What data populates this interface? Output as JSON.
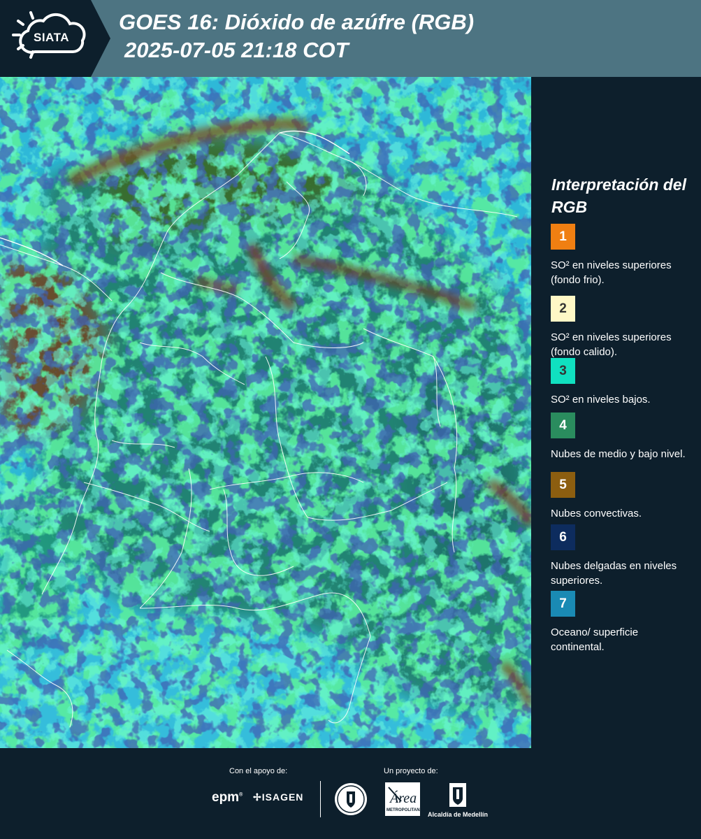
{
  "header": {
    "logo_text": "SIATA",
    "title_line1": "GOES 16: Dióxido de azúfre (RGB)",
    "title_line2": "2025-07-05 21:18 COT"
  },
  "legend": {
    "title": "Interpretación del RGB",
    "items": [
      {
        "number": "1",
        "color": "#f07f12",
        "text_color": "#ffffff",
        "desc": "SO² en niveles superiores (fondo frio)."
      },
      {
        "number": "2",
        "color": "#fff8c6",
        "text_color": "#333333",
        "desc": "SO² en niveles superiores (fondo calido)."
      },
      {
        "number": "3",
        "color": "#10e0c0",
        "text_color": "#333333",
        "desc": "SO² en niveles bajos."
      },
      {
        "number": "4",
        "color": "#2a8c5e",
        "text_color": "#ffffff",
        "desc": "Nubes de medio y bajo nivel."
      },
      {
        "number": "5",
        "color": "#8c5e10",
        "text_color": "#ffffff",
        "desc": "Nubes convectivas."
      },
      {
        "number": "6",
        "color": "#0d2c5e",
        "text_color": "#ffffff",
        "desc": "Nubes delgadas en niveles superiores."
      },
      {
        "number": "7",
        "color": "#1a8ab4",
        "text_color": "#ffffff",
        "desc": "Oceano/ superficie continental."
      }
    ]
  },
  "footer": {
    "support_label": "Con el apoyo de:",
    "project_label": "Un proyecto de:",
    "sponsor_epm": "epm",
    "sponsor_isagen": "ISAGEN",
    "metro_text": "METROPOLITANA",
    "alcaldia_text": "Alcaldía de Medellín"
  },
  "colors": {
    "header_bg": "#4d7482",
    "panel_bg": "#0d1f2c",
    "ocean": "#2eb8d8"
  }
}
